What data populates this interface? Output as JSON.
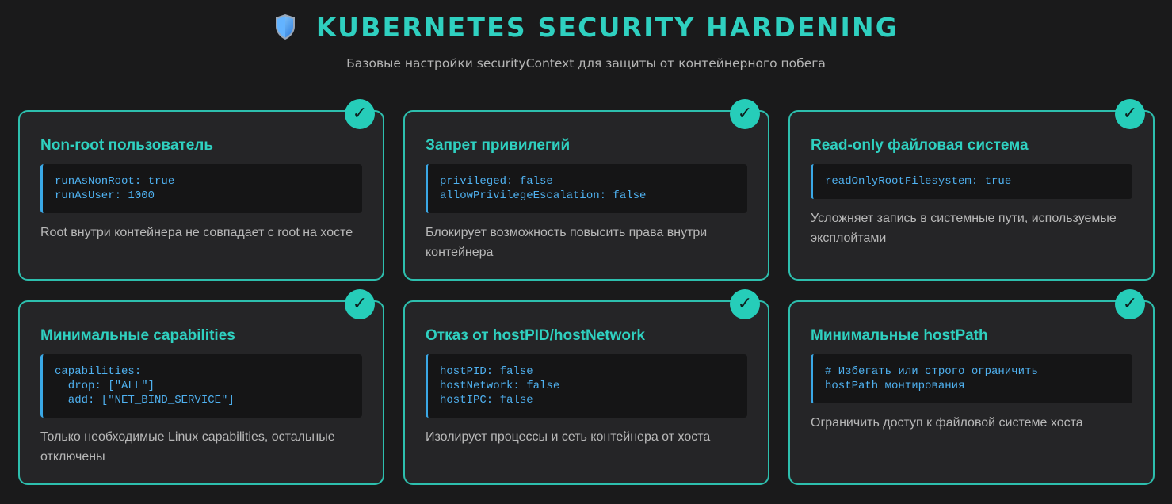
{
  "header": {
    "title": "KUBERNETES SECURITY HARDENING",
    "subtitle": "Базовые настройки securityContext для защиты от контейнерного побега",
    "icon": "shield-icon"
  },
  "colors": {
    "accent": "#2fd0c0",
    "code_text": "#4fb1f0",
    "background": "#1a1a1b",
    "card_background": "#252527"
  },
  "cards": [
    {
      "title": "Non-root пользователь",
      "code": "runAsNonRoot: true\nrunAsUser: 1000",
      "description": "Root внутри контейнера не совпадает с root на хосте",
      "check": "✓"
    },
    {
      "title": "Запрет привилегий",
      "code": "privileged: false\nallowPrivilegeEscalation: false",
      "description": "Блокирует возможность повысить права внутри контейнера",
      "check": "✓"
    },
    {
      "title": "Read-only файловая система",
      "code": "readOnlyRootFilesystem: true",
      "description": "Усложняет запись в системные пути, используемые эксплойтами",
      "check": "✓"
    },
    {
      "title": "Минимальные capabilities",
      "code": "capabilities:\n  drop: [\"ALL\"]\n  add: [\"NET_BIND_SERVICE\"]",
      "description": "Только необходимые Linux capabilities, остальные отключены",
      "check": "✓"
    },
    {
      "title": "Отказ от hostPID/hostNetwork",
      "code": "hostPID: false\nhostNetwork: false\nhostIPC: false",
      "description": "Изолирует процессы и сеть контейнера от хоста",
      "check": "✓"
    },
    {
      "title": "Минимальные hostPath",
      "code": "# Избегать или строго ограничить\nhostPath монтирования",
      "description": "Ограничить доступ к файловой системе хоста",
      "check": "✓"
    }
  ]
}
